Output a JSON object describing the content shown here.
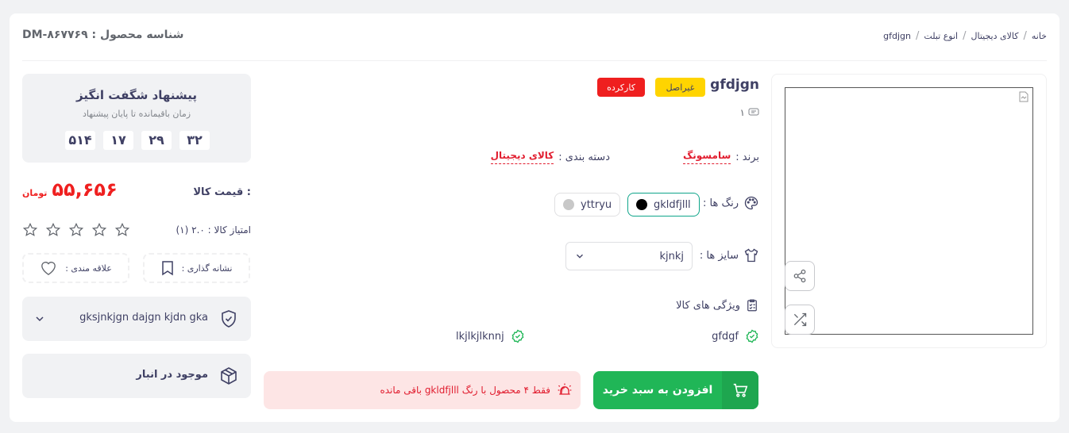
{
  "breadcrumb": [
    "خانه",
    "کالای دیجیتال",
    "انوع تبلت",
    "gfdjgn"
  ],
  "product_id": "شناسه محصول :  DM-۸۶۷۷۶۹",
  "product": {
    "title": "gfdjgn",
    "badges": [
      "غیراصل",
      "کارکرده"
    ],
    "comments_count": "۱",
    "brand_label": "برند :",
    "brand_value": "سامسونگ",
    "category_label": "دسته بندی :",
    "category_value": "کالای دیجیتال"
  },
  "colors": {
    "label": "رنگ ها :",
    "options": [
      {
        "name": "gkldfjlll",
        "hex": "#000000",
        "active": true
      },
      {
        "name": "yttryu",
        "hex": "#c8c8c8",
        "active": false
      }
    ]
  },
  "sizes": {
    "label": "سایز ها :",
    "selected": "kjnkj"
  },
  "features": {
    "label": "ویژگی های کالا",
    "items": [
      "gfdgf",
      "lkjlkjlknnj"
    ]
  },
  "actions": {
    "add_to_cart": "افزودن به سبد خرید",
    "stock_alert": "فقط ۴ محصول با رنگ gkldfjlll باقی مانده"
  },
  "offer": {
    "title": "پیشنهاد شگفت انگیز",
    "subtitle": "زمان باقیمانده تا پایان پیشنهاد",
    "timer": [
      "۵۱۴",
      "۱۷",
      "۲۹",
      "۳۲"
    ]
  },
  "price": {
    "label": "قیمت کالا :",
    "value": "۵۵,۶۵۶",
    "currency": "تومان"
  },
  "rating": {
    "label": "امتیاز کالا :  ۲.۰ (۱)",
    "value": 2,
    "max": 5
  },
  "bookmark_label": "نشانه گذاری :",
  "favorite_label": "علاقه مندی :",
  "warranty": "gksjnkjgn dajgn kjdn gka",
  "stock_status": "موجود در انبار"
}
